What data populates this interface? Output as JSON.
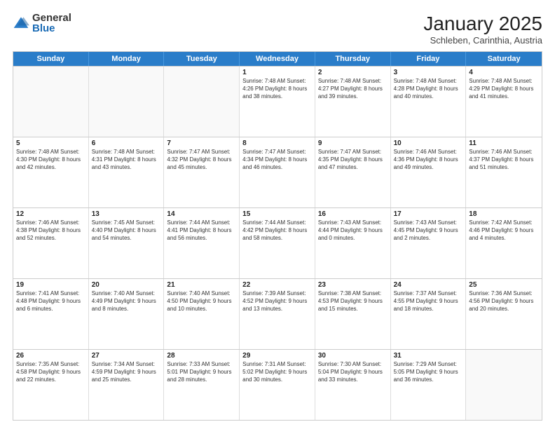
{
  "logo": {
    "general": "General",
    "blue": "Blue"
  },
  "header": {
    "title": "January 2025",
    "subtitle": "Schleben, Carinthia, Austria"
  },
  "weekdays": [
    "Sunday",
    "Monday",
    "Tuesday",
    "Wednesday",
    "Thursday",
    "Friday",
    "Saturday"
  ],
  "weeks": [
    [
      {
        "day": "",
        "info": "",
        "empty": true
      },
      {
        "day": "",
        "info": "",
        "empty": true
      },
      {
        "day": "",
        "info": "",
        "empty": true
      },
      {
        "day": "1",
        "info": "Sunrise: 7:48 AM\nSunset: 4:26 PM\nDaylight: 8 hours\nand 38 minutes."
      },
      {
        "day": "2",
        "info": "Sunrise: 7:48 AM\nSunset: 4:27 PM\nDaylight: 8 hours\nand 39 minutes."
      },
      {
        "day": "3",
        "info": "Sunrise: 7:48 AM\nSunset: 4:28 PM\nDaylight: 8 hours\nand 40 minutes."
      },
      {
        "day": "4",
        "info": "Sunrise: 7:48 AM\nSunset: 4:29 PM\nDaylight: 8 hours\nand 41 minutes."
      }
    ],
    [
      {
        "day": "5",
        "info": "Sunrise: 7:48 AM\nSunset: 4:30 PM\nDaylight: 8 hours\nand 42 minutes."
      },
      {
        "day": "6",
        "info": "Sunrise: 7:48 AM\nSunset: 4:31 PM\nDaylight: 8 hours\nand 43 minutes."
      },
      {
        "day": "7",
        "info": "Sunrise: 7:47 AM\nSunset: 4:32 PM\nDaylight: 8 hours\nand 45 minutes."
      },
      {
        "day": "8",
        "info": "Sunrise: 7:47 AM\nSunset: 4:34 PM\nDaylight: 8 hours\nand 46 minutes."
      },
      {
        "day": "9",
        "info": "Sunrise: 7:47 AM\nSunset: 4:35 PM\nDaylight: 8 hours\nand 47 minutes."
      },
      {
        "day": "10",
        "info": "Sunrise: 7:46 AM\nSunset: 4:36 PM\nDaylight: 8 hours\nand 49 minutes."
      },
      {
        "day": "11",
        "info": "Sunrise: 7:46 AM\nSunset: 4:37 PM\nDaylight: 8 hours\nand 51 minutes."
      }
    ],
    [
      {
        "day": "12",
        "info": "Sunrise: 7:46 AM\nSunset: 4:38 PM\nDaylight: 8 hours\nand 52 minutes."
      },
      {
        "day": "13",
        "info": "Sunrise: 7:45 AM\nSunset: 4:40 PM\nDaylight: 8 hours\nand 54 minutes."
      },
      {
        "day": "14",
        "info": "Sunrise: 7:44 AM\nSunset: 4:41 PM\nDaylight: 8 hours\nand 56 minutes."
      },
      {
        "day": "15",
        "info": "Sunrise: 7:44 AM\nSunset: 4:42 PM\nDaylight: 8 hours\nand 58 minutes."
      },
      {
        "day": "16",
        "info": "Sunrise: 7:43 AM\nSunset: 4:44 PM\nDaylight: 9 hours\nand 0 minutes."
      },
      {
        "day": "17",
        "info": "Sunrise: 7:43 AM\nSunset: 4:45 PM\nDaylight: 9 hours\nand 2 minutes."
      },
      {
        "day": "18",
        "info": "Sunrise: 7:42 AM\nSunset: 4:46 PM\nDaylight: 9 hours\nand 4 minutes."
      }
    ],
    [
      {
        "day": "19",
        "info": "Sunrise: 7:41 AM\nSunset: 4:48 PM\nDaylight: 9 hours\nand 6 minutes."
      },
      {
        "day": "20",
        "info": "Sunrise: 7:40 AM\nSunset: 4:49 PM\nDaylight: 9 hours\nand 8 minutes."
      },
      {
        "day": "21",
        "info": "Sunrise: 7:40 AM\nSunset: 4:50 PM\nDaylight: 9 hours\nand 10 minutes."
      },
      {
        "day": "22",
        "info": "Sunrise: 7:39 AM\nSunset: 4:52 PM\nDaylight: 9 hours\nand 13 minutes."
      },
      {
        "day": "23",
        "info": "Sunrise: 7:38 AM\nSunset: 4:53 PM\nDaylight: 9 hours\nand 15 minutes."
      },
      {
        "day": "24",
        "info": "Sunrise: 7:37 AM\nSunset: 4:55 PM\nDaylight: 9 hours\nand 18 minutes."
      },
      {
        "day": "25",
        "info": "Sunrise: 7:36 AM\nSunset: 4:56 PM\nDaylight: 9 hours\nand 20 minutes."
      }
    ],
    [
      {
        "day": "26",
        "info": "Sunrise: 7:35 AM\nSunset: 4:58 PM\nDaylight: 9 hours\nand 22 minutes."
      },
      {
        "day": "27",
        "info": "Sunrise: 7:34 AM\nSunset: 4:59 PM\nDaylight: 9 hours\nand 25 minutes."
      },
      {
        "day": "28",
        "info": "Sunrise: 7:33 AM\nSunset: 5:01 PM\nDaylight: 9 hours\nand 28 minutes."
      },
      {
        "day": "29",
        "info": "Sunrise: 7:31 AM\nSunset: 5:02 PM\nDaylight: 9 hours\nand 30 minutes."
      },
      {
        "day": "30",
        "info": "Sunrise: 7:30 AM\nSunset: 5:04 PM\nDaylight: 9 hours\nand 33 minutes."
      },
      {
        "day": "31",
        "info": "Sunrise: 7:29 AM\nSunset: 5:05 PM\nDaylight: 9 hours\nand 36 minutes."
      },
      {
        "day": "",
        "info": "",
        "empty": true
      }
    ]
  ]
}
